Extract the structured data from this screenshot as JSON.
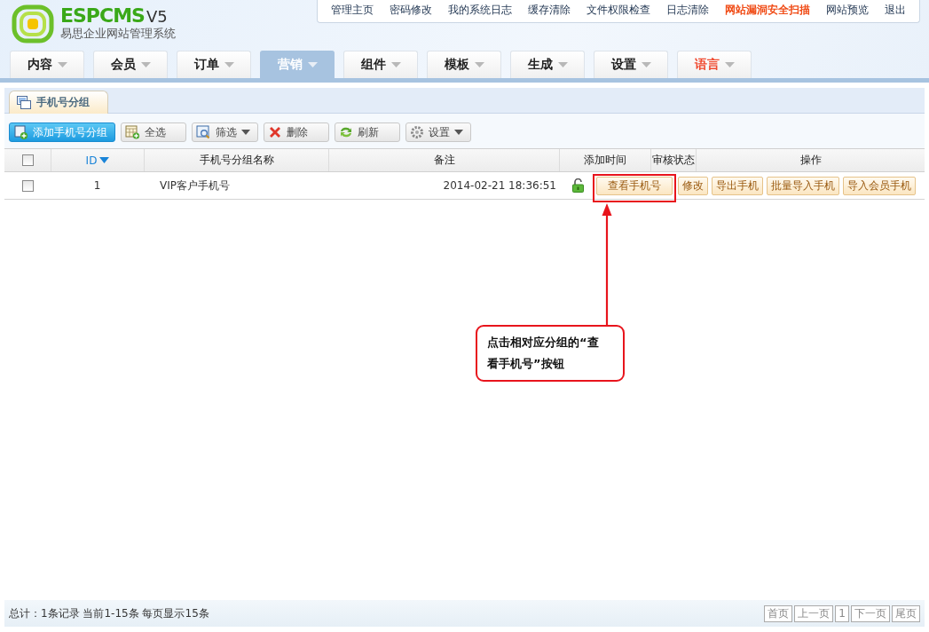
{
  "logo": {
    "brand": "ESPCMS",
    "version": "V5",
    "subtitle": "易思企业网站管理系统"
  },
  "top_links": [
    {
      "label": "管理主页",
      "highlight": false
    },
    {
      "label": "密码修改",
      "highlight": false
    },
    {
      "label": "我的系统日志",
      "highlight": false
    },
    {
      "label": "缓存清除",
      "highlight": false
    },
    {
      "label": "文件权限检查",
      "highlight": false
    },
    {
      "label": "日志清除",
      "highlight": false
    },
    {
      "label": "网站漏洞安全扫描",
      "highlight": true
    },
    {
      "label": "网站预览",
      "highlight": false
    },
    {
      "label": "退出",
      "highlight": false
    }
  ],
  "nav_tabs": [
    {
      "label": "内容",
      "selected": false,
      "highlight": false
    },
    {
      "label": "会员",
      "selected": false,
      "highlight": false
    },
    {
      "label": "订单",
      "selected": false,
      "highlight": false
    },
    {
      "label": "营销",
      "selected": true,
      "highlight": false
    },
    {
      "label": "组件",
      "selected": false,
      "highlight": false
    },
    {
      "label": "模板",
      "selected": false,
      "highlight": false
    },
    {
      "label": "生成",
      "selected": false,
      "highlight": false
    },
    {
      "label": "设置",
      "selected": false,
      "highlight": false
    },
    {
      "label": "语言",
      "selected": false,
      "highlight": true
    }
  ],
  "panel_tab": "手机号分组",
  "toolbar": [
    {
      "kind": "add",
      "label": "添加手机号分组",
      "primary": true,
      "dropdown": false
    },
    {
      "kind": "select-all",
      "label": "全选",
      "primary": false,
      "dropdown": false
    },
    {
      "kind": "filter",
      "label": "筛选",
      "primary": false,
      "dropdown": true
    },
    {
      "kind": "delete",
      "label": "删除",
      "primary": false,
      "dropdown": false
    },
    {
      "kind": "refresh",
      "label": "刷新",
      "primary": false,
      "dropdown": false
    },
    {
      "kind": "settings",
      "label": "设置",
      "primary": false,
      "dropdown": true
    }
  ],
  "table": {
    "columns": [
      "ID",
      "手机号分组名称",
      "备注",
      "添加时间",
      "审核状态",
      "操作"
    ],
    "header_checked": false,
    "rows": [
      {
        "checked": false,
        "id": "1",
        "name": "VIP客户手机号",
        "time": "2014-02-21 18:36:51",
        "unlocked": true,
        "actions": [
          "查看手机号",
          "修改",
          "导出手机",
          "批量导入手机",
          "导入会员手机"
        ]
      }
    ]
  },
  "annotation": {
    "text": "点击相对应分组的“查看手机号”按钮"
  },
  "status_bar": {
    "summary": "总计：1条记录 当前1-15条 每页显示15条",
    "pager": [
      "首页",
      "上一页",
      "1",
      "下一页",
      "尾页"
    ]
  }
}
